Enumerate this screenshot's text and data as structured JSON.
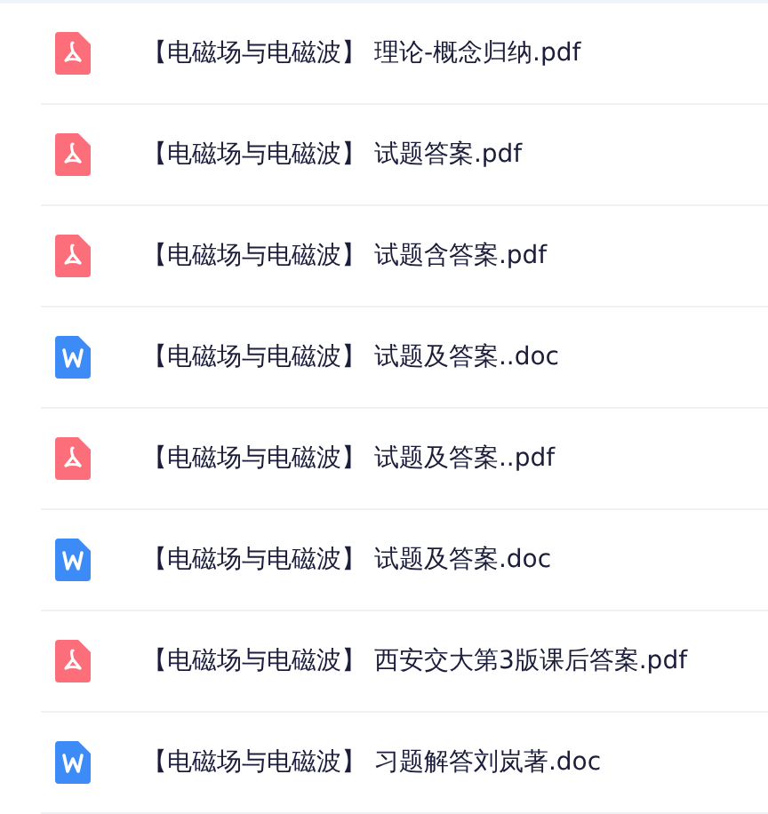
{
  "files": [
    {
      "kind": "pdf",
      "name": "【电磁场与电磁波】 理论-概念归纳.pdf"
    },
    {
      "kind": "pdf",
      "name": "【电磁场与电磁波】 试题答案.pdf"
    },
    {
      "kind": "pdf",
      "name": "【电磁场与电磁波】 试题含答案.pdf"
    },
    {
      "kind": "doc",
      "name": "【电磁场与电磁波】 试题及答案..doc"
    },
    {
      "kind": "pdf",
      "name": "【电磁场与电磁波】 试题及答案..pdf"
    },
    {
      "kind": "doc",
      "name": "【电磁场与电磁波】 试题及答案.doc"
    },
    {
      "kind": "pdf",
      "name": "【电磁场与电磁波】 西安交大第3版课后答案.pdf"
    },
    {
      "kind": "doc",
      "name": "【电磁场与电磁波】 习题解答刘岚著.doc"
    }
  ]
}
